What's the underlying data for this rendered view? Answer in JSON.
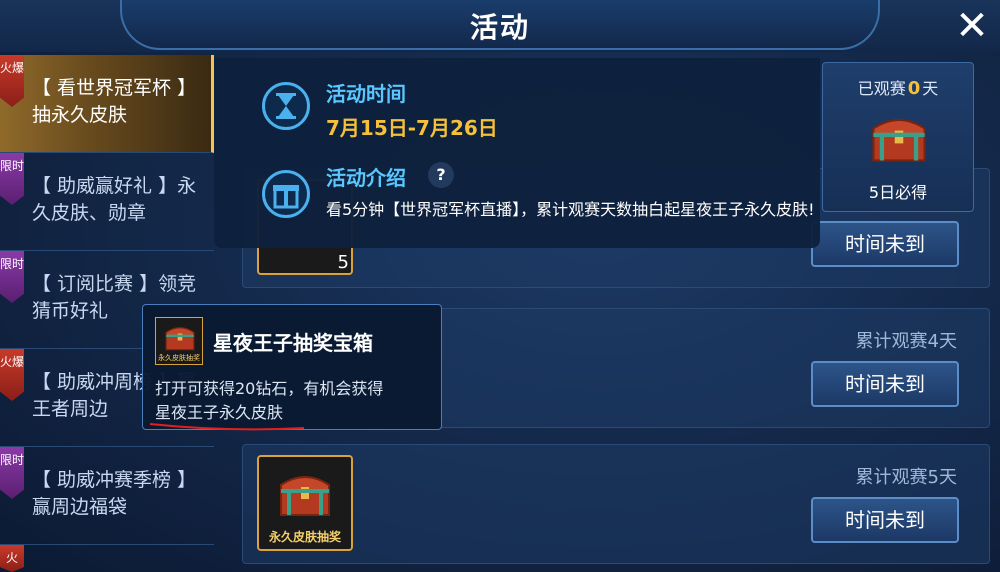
{
  "header": {
    "title": "活动",
    "close_icon": "close-icon"
  },
  "sidebar": {
    "items": [
      {
        "badge": "火爆",
        "badge_type": "hot",
        "label": "【 看世界冠军杯 】抽永久皮肤",
        "active": true
      },
      {
        "badge": "限时",
        "badge_type": "limited",
        "label": "【 助威赢好礼 】永久皮肤、勋章",
        "active": false
      },
      {
        "badge": "限时",
        "badge_type": "limited",
        "label": "【 订阅比赛 】领竞猜币好礼",
        "active": false
      },
      {
        "badge": "火爆",
        "badge_type": "hot",
        "label": "【 助威冲周榜 】赢王者周边",
        "active": false
      },
      {
        "badge": "限时",
        "badge_type": "limited",
        "label": "【 助威冲赛季榜 】赢周边福袋",
        "active": false
      },
      {
        "badge": "火",
        "badge_type": "hot",
        "label": "",
        "active": false
      }
    ]
  },
  "info": {
    "time_label": "活动时间",
    "time_value": "7月15日-7月26日",
    "intro_label": "活动介绍",
    "help_mark": "?",
    "intro_text": "看5分钟【世界冠军杯直播】，累计观赛天数抽白起星夜王子永久皮肤!"
  },
  "progress": {
    "prefix": "已观赛",
    "days": "0",
    "suffix": "天",
    "guarantee": "5日必得"
  },
  "rows": [
    {
      "requirement": "",
      "button": "时间未到",
      "count": "5"
    },
    {
      "requirement": "累计观赛4天",
      "button": "时间未到"
    },
    {
      "requirement": "累计观赛5天",
      "button": "时间未到",
      "reward_caption": "永久皮肤抽奖"
    }
  ],
  "tooltip": {
    "title": "星夜王子抽奖宝箱",
    "icon_caption": "永久皮肤抽奖",
    "desc_line1": "打开可获得20钻石，有机会获得",
    "desc_line2": "星夜王子永久皮肤"
  },
  "colors": {
    "accent_gold": "#f5c13a",
    "accent_blue": "#5ac8ff",
    "hot_badge": "#c83a2a",
    "limited_badge": "#8a3aa8"
  }
}
